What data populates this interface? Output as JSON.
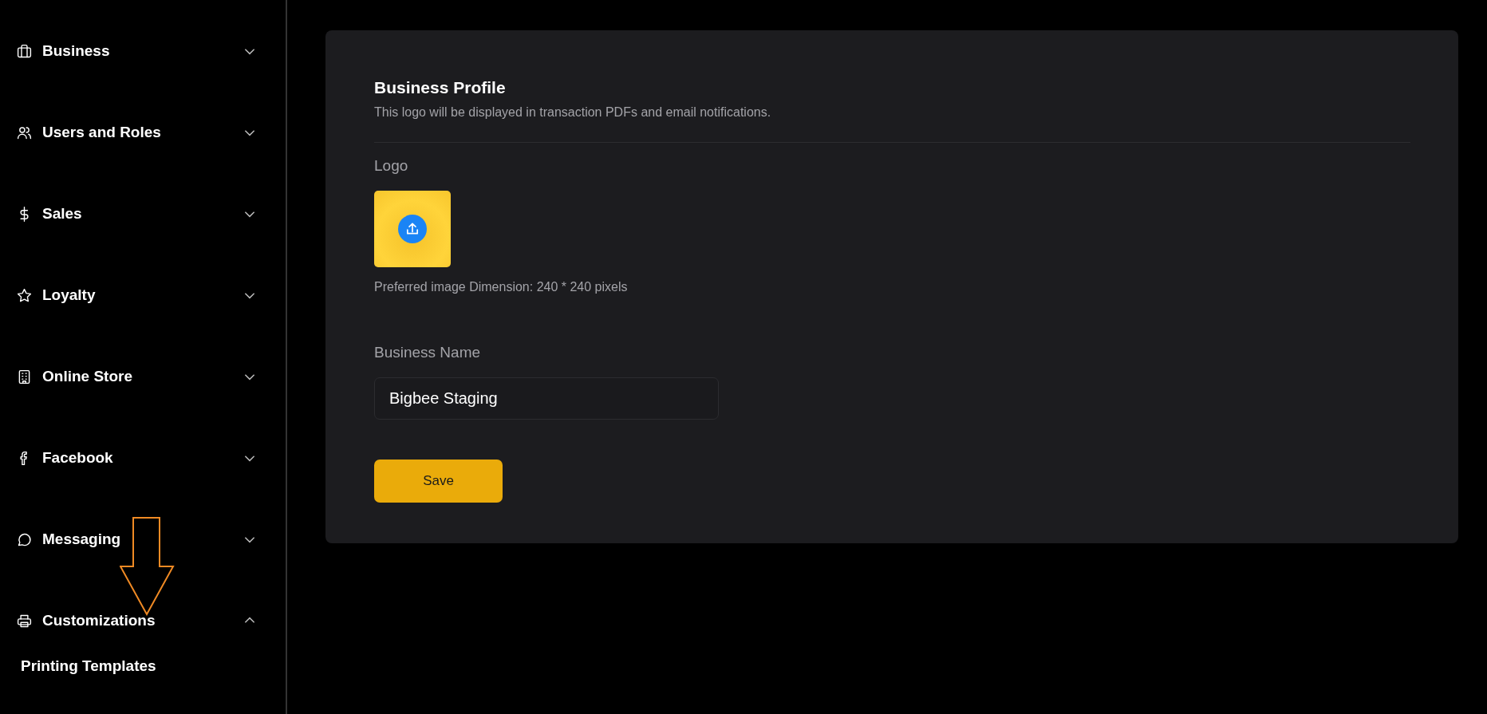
{
  "sidebar": {
    "items": [
      {
        "label": "Business",
        "expanded": false
      },
      {
        "label": "Users and Roles",
        "expanded": false
      },
      {
        "label": "Sales",
        "expanded": false
      },
      {
        "label": "Loyalty",
        "expanded": false
      },
      {
        "label": "Online Store",
        "expanded": false
      },
      {
        "label": "Facebook",
        "expanded": false
      },
      {
        "label": "Messaging",
        "expanded": false
      },
      {
        "label": "Customizations",
        "expanded": true,
        "children": [
          {
            "label": "Printing Templates"
          }
        ]
      }
    ]
  },
  "profile": {
    "title": "Business Profile",
    "subtitle": "This logo will be displayed in transaction PDFs and email notifications.",
    "logo_label": "Logo",
    "logo_hint": "Preferred image Dimension: 240 * 240 pixels",
    "name_label": "Business Name",
    "name_value": "Bigbee Staging",
    "save_button": "Save"
  }
}
